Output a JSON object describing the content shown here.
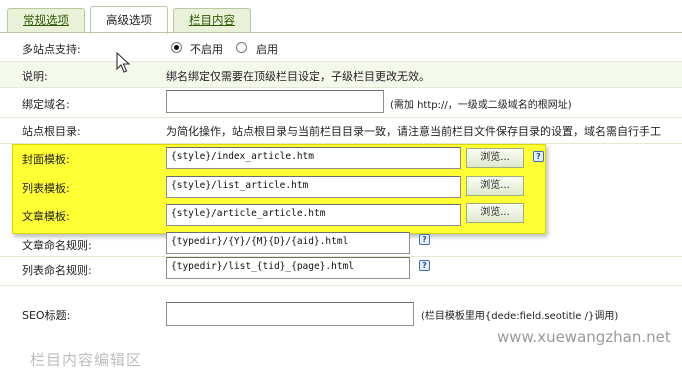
{
  "tabs": [
    "常规选项",
    "高级选项",
    "栏目内容"
  ],
  "multisite": {
    "label": "多站点支持:",
    "options": [
      {
        "label": "不启用",
        "checked": true
      },
      {
        "label": "启用",
        "checked": false
      }
    ]
  },
  "note": {
    "label": "说明:",
    "text": "绑名绑定仅需要在顶级栏目设定，子级栏目更改无效。"
  },
  "domain": {
    "label": "绑定域名:",
    "value": "",
    "hint": "(需加 http://，一级或二级域名的根网址)"
  },
  "site_root": {
    "label": "站点根目录:",
    "text": "为简化操作，站点根目录与当前栏目目录一致，请注意当前栏目文件保存目录的设置，域名需自行手工"
  },
  "templates": [
    {
      "label": "封面模板:",
      "value": "{style}/index_article.htm",
      "button": "浏览..."
    },
    {
      "label": "列表模板:",
      "value": "{style}/list_article.htm",
      "button": "浏览..."
    },
    {
      "label": "文章模板:",
      "value": "{style}/article_article.htm",
      "button": "浏览..."
    }
  ],
  "naming_rules": [
    {
      "label": "文章命名规则:",
      "value": "{typedir}/{Y}/{M}{D}/{aid}.html"
    },
    {
      "label": "列表命名规则:",
      "value": "{typedir}/list_{tid}_{page}.html"
    }
  ],
  "seo": {
    "label": "SEO标题:",
    "value": "",
    "hint": "(栏目模板里用{dede:field.seotitle /}调用)"
  },
  "help_glyph": "?",
  "watermark": "www.xuewangzhan.net",
  "bottom_cut_text": "栏目内容编辑区"
}
